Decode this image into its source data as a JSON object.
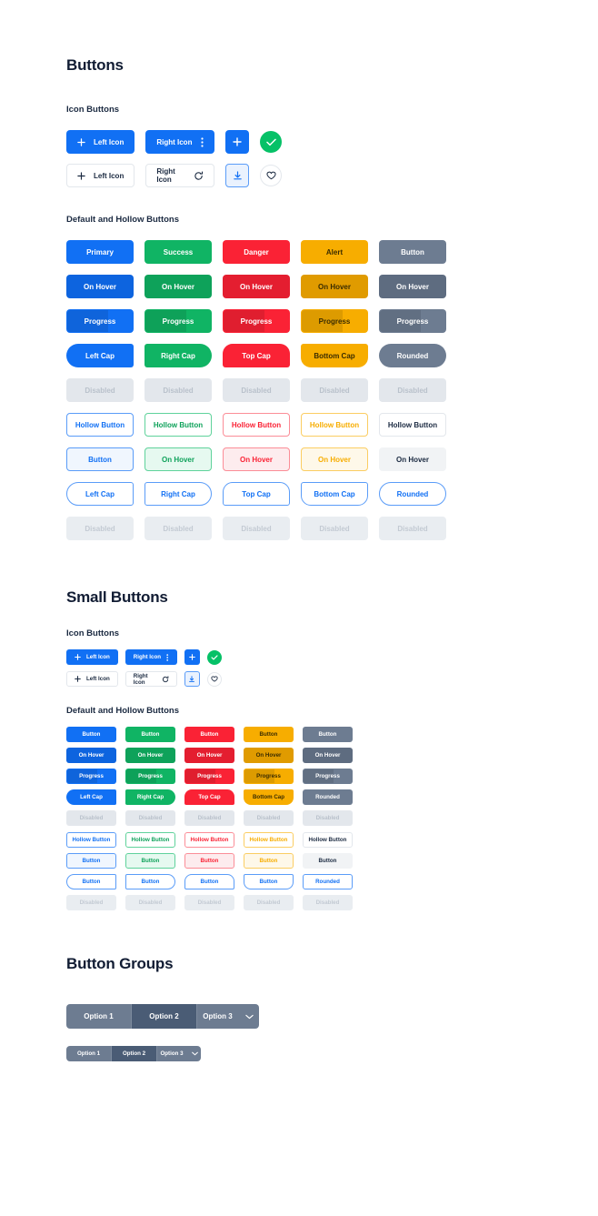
{
  "sections": {
    "buttons": {
      "title": "Buttons"
    },
    "small_buttons": {
      "title": "Small Buttons"
    },
    "button_groups": {
      "title": "Button Groups"
    }
  },
  "subheadings": {
    "icon_buttons": "Icon Buttons",
    "default_hollow": "Default and Hollow Buttons"
  },
  "icon_buttons": {
    "filled": {
      "left_icon": "Left Icon",
      "right_icon": "Right Icon"
    },
    "outline": {
      "left_icon": "Left Icon",
      "right_icon": "Right Icon"
    },
    "icons": {
      "plus": "plus-icon",
      "kebab": "kebab-menu-icon",
      "refresh": "refresh-icon",
      "check": "check-icon",
      "download": "download-icon",
      "heart": "heart-icon"
    }
  },
  "default_buttons": {
    "row_default": [
      "Primary",
      "Success",
      "Danger",
      "Alert",
      "Button"
    ],
    "row_hover": [
      "On Hover",
      "On Hover",
      "On Hover",
      "On Hover",
      "On Hover"
    ],
    "row_progress": [
      "Progress",
      "Progress",
      "Progress",
      "Progress",
      "Progress"
    ],
    "row_caps": [
      "Left Cap",
      "Right Cap",
      "Top Cap",
      "Bottom Cap",
      "Rounded"
    ],
    "row_disabled": [
      "Disabled",
      "Disabled",
      "Disabled",
      "Disabled",
      "Disabled"
    ]
  },
  "hollow_buttons": {
    "row_default": [
      "Hollow Button",
      "Hollow Button",
      "Hollow Button",
      "Hollow Button",
      "Hollow Button"
    ],
    "row_hover": [
      "Button",
      "On Hover",
      "On Hover",
      "On Hover",
      "On Hover"
    ],
    "row_caps": [
      "Left Cap",
      "Right Cap",
      "Top Cap",
      "Bottom Cap",
      "Rounded"
    ],
    "row_disabled": [
      "Disabled",
      "Disabled",
      "Disabled",
      "Disabled",
      "Disabled"
    ]
  },
  "small_default_buttons": {
    "row_default": [
      "Button",
      "Button",
      "Button",
      "Button",
      "Button"
    ],
    "row_hover": [
      "On Hover",
      "On Hover",
      "On Hover",
      "On Hover",
      "On Hover"
    ],
    "row_progress": [
      "Progress",
      "Progress",
      "Progress",
      "Progress",
      "Progress"
    ],
    "row_caps": [
      "Left Cap",
      "Right Cap",
      "Top Cap",
      "Bottom Cap",
      "Rounded"
    ],
    "row_disabled": [
      "Disabled",
      "Disabled",
      "Disabled",
      "Disabled",
      "Disabled"
    ]
  },
  "small_hollow_buttons": {
    "row_default": [
      "Hollow Button",
      "Hollow Button",
      "Hollow Button",
      "Hollow Button",
      "Hollow Button"
    ],
    "row_hover": [
      "Button",
      "Button",
      "Button",
      "Button",
      "Button"
    ],
    "row_caps": [
      "Button",
      "Button",
      "Button",
      "Button",
      "Rounded"
    ],
    "row_disabled": [
      "Disabled",
      "Disabled",
      "Disabled",
      "Disabled",
      "Disabled"
    ]
  },
  "button_groups": {
    "large": [
      "Option 1",
      "Option 2",
      "Option 3"
    ],
    "small": [
      "Option 1",
      "Option 2",
      "Option 3"
    ],
    "active_index": 1,
    "chevron": "chevron-down-icon"
  },
  "colors": {
    "primary": "#1170f4",
    "success": "#10b464",
    "danger": "#fa2235",
    "alert": "#f7ad00",
    "gray": "#6d7c91",
    "green_circle": "#06c167",
    "disabled_bg": "#e3e7ec",
    "group_active": "#4a5c75"
  }
}
